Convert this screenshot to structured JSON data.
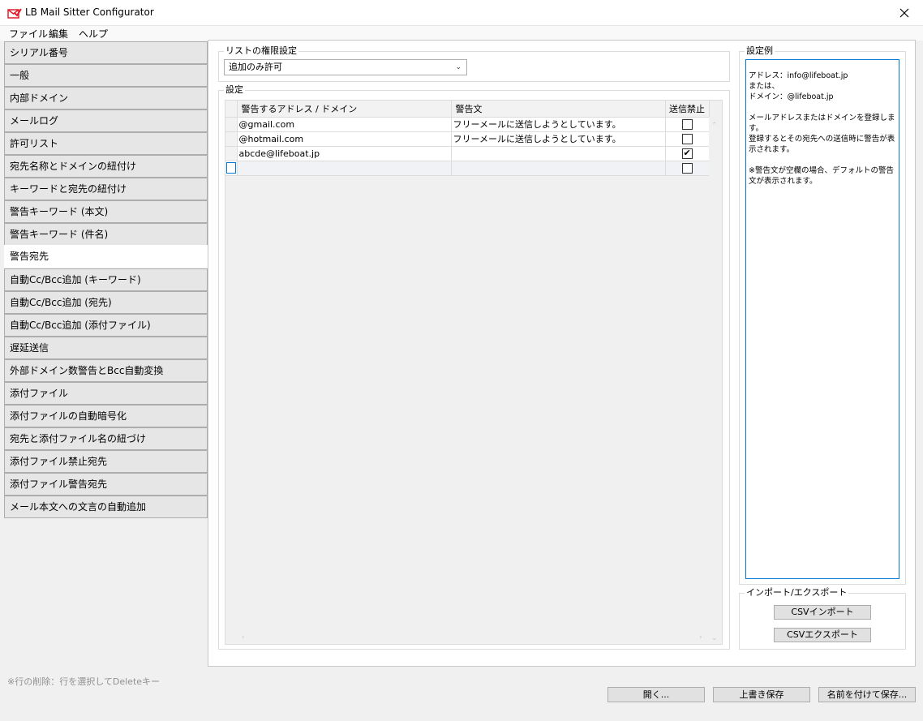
{
  "window": {
    "title": "LB Mail Sitter Configurator"
  },
  "menu": [
    "ファイル",
    "編集",
    "ヘルプ"
  ],
  "sidebar": {
    "items": [
      "シリアル番号",
      "一般",
      "内部ドメイン",
      "メールログ",
      "許可リスト",
      "宛先名称とドメインの紐付け",
      "キーワードと宛先の紐付け",
      "警告キーワード (本文)",
      "警告キーワード (件名)",
      "警告宛先",
      "自動Cc/Bcc追加 (キーワード)",
      "自動Cc/Bcc追加 (宛先)",
      "自動Cc/Bcc追加 (添付ファイル)",
      "遅延送信",
      "外部ドメイン数警告とBcc自動変換",
      "添付ファイル",
      "添付ファイルの自動暗号化",
      "宛先と添付ファイル名の紐づけ",
      "添付ファイル禁止宛先",
      "添付ファイル警告宛先",
      "メール本文への文言の自動追加"
    ],
    "active_index": 9
  },
  "permission": {
    "label": "リストの権限設定",
    "selected": "追加のみ許可"
  },
  "settings": {
    "label": "設定",
    "columns": [
      "警告するアドレス / ドメイン",
      "警告文",
      "送信禁止"
    ],
    "rows": [
      {
        "address": "@gmail.com",
        "message": "フリーメールに送信しようとしています。",
        "blocked": false
      },
      {
        "address": "@hotmail.com",
        "message": "フリーメールに送信しようとしています。",
        "blocked": false
      },
      {
        "address": "abcde@lifeboat.jp",
        "message": "",
        "blocked": true
      },
      {
        "address": "",
        "message": "",
        "blocked": false
      }
    ]
  },
  "example": {
    "label": "設定例",
    "text": "アドレス：info@lifeboat.jp\nまたは、\nドメイン：@lifeboat.jp\n\nメールアドレスまたはドメインを登録します。\n登録するとその宛先への送信時に警告が表示されます。\n\n※警告文が空欄の場合、デフォルトの警告文が表示されます。"
  },
  "import_export": {
    "label": "インポート/エクスポート",
    "import_button": "CSVインポート",
    "export_button": "CSVエクスポート"
  },
  "footer": {
    "hint": "※行の削除：行を選択してDeleteキー",
    "open_button": "開く...",
    "save_button": "上書き保存",
    "save_as_button": "名前を付けて保存..."
  },
  "colors": {
    "accent": "#0078d7",
    "app_icon": "#e11e2d"
  },
  "icons": {
    "app": "mail-check-icon",
    "close": "close-icon",
    "dropdown": "chevron-down-icon"
  }
}
